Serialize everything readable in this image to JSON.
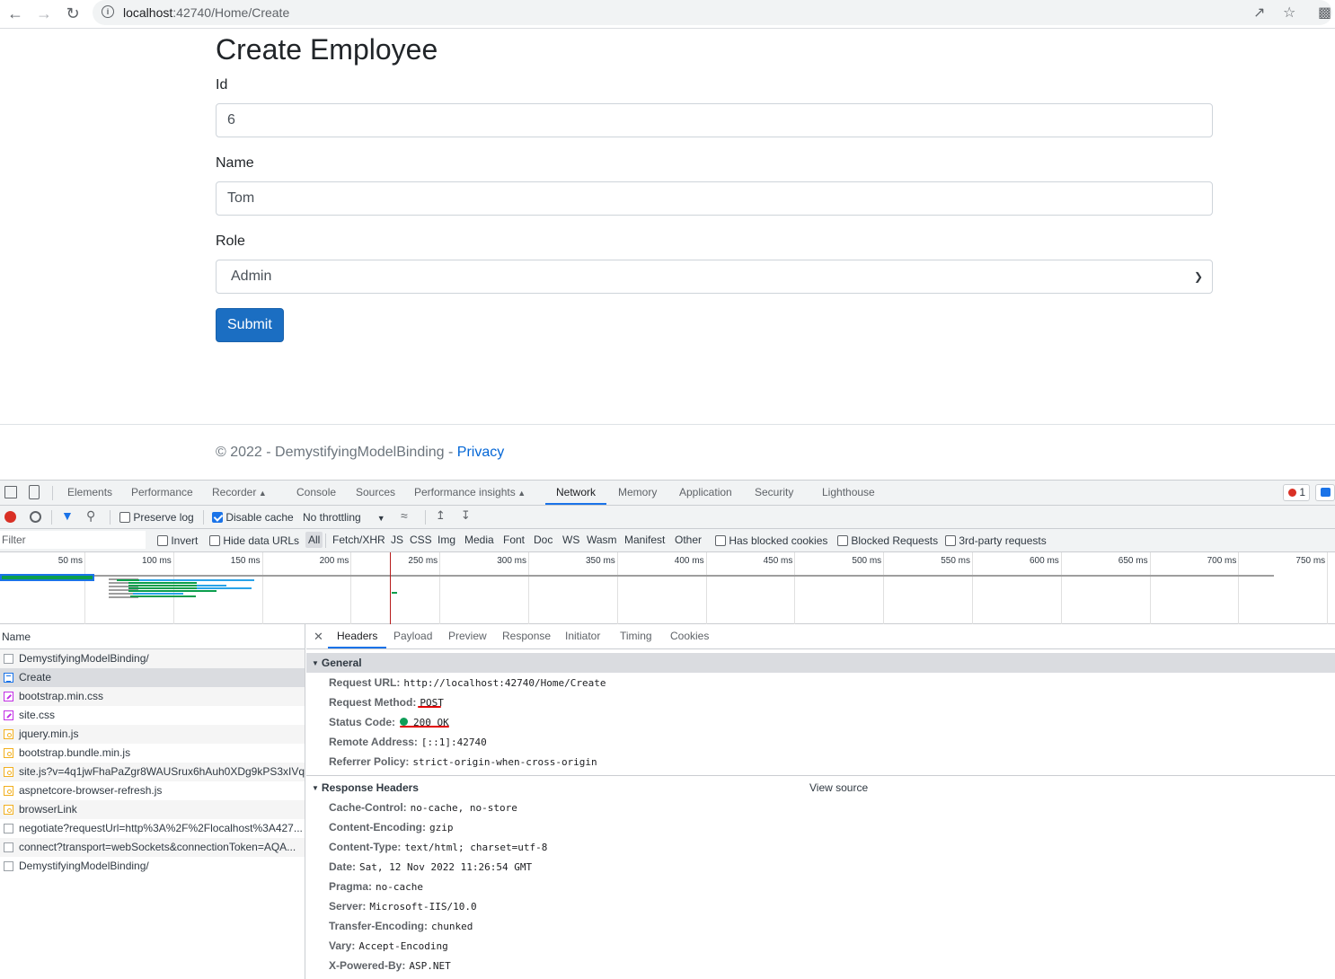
{
  "browser": {
    "url_host": "localhost",
    "url_rest": ":42740/Home/Create",
    "icons": {
      "back": "arrow-left-icon",
      "forward": "arrow-right-icon",
      "reload": "reload-icon",
      "site_info": "info-icon",
      "share": "share-icon",
      "bookmark": "star-icon",
      "extensions": "puzzle-icon"
    }
  },
  "page": {
    "title": "Create Employee",
    "fields": [
      {
        "label": "Id",
        "value": "6"
      },
      {
        "label": "Name",
        "value": "Tom"
      }
    ],
    "role": {
      "label": "Role",
      "selected": "Admin"
    },
    "submit_label": "Submit",
    "footer": {
      "text": "© 2022 - DemystifyingModelBinding - ",
      "link": "Privacy"
    }
  },
  "devtools": {
    "tabs": [
      "Elements",
      "Performance",
      "Recorder",
      "Console",
      "Sources",
      "Performance insights",
      "Network",
      "Memory",
      "Application",
      "Security",
      "Lighthouse"
    ],
    "active_tab": "Network",
    "error_count": "1",
    "toolbar": {
      "preserve_log": "Preserve log",
      "preserve_log_checked": false,
      "disable_cache": "Disable cache",
      "disable_cache_checked": true,
      "throttling": "No throttling"
    },
    "filterbar": {
      "placeholder": "Filter",
      "invert": "Invert",
      "hide_data_urls": "Hide data URLs",
      "types": [
        "All",
        "Fetch/XHR",
        "JS",
        "CSS",
        "Img",
        "Media",
        "Font",
        "Doc",
        "WS",
        "Wasm",
        "Manifest",
        "Other"
      ],
      "active_type": "All",
      "has_blocked_cookies": "Has blocked cookies",
      "blocked_requests": "Blocked Requests",
      "third_party": "3rd-party requests"
    },
    "overview_ticks": [
      "50 ms",
      "100 ms",
      "150 ms",
      "200 ms",
      "250 ms",
      "300 ms",
      "350 ms",
      "400 ms",
      "450 ms",
      "500 ms",
      "550 ms",
      "600 ms",
      "650 ms",
      "700 ms",
      "750 ms"
    ],
    "requests_header": "Name",
    "requests": [
      {
        "name": "DemystifyingModelBinding/",
        "type": "other"
      },
      {
        "name": "Create",
        "type": "doc",
        "selected": true
      },
      {
        "name": "bootstrap.min.css",
        "type": "css"
      },
      {
        "name": "site.css",
        "type": "css"
      },
      {
        "name": "jquery.min.js",
        "type": "js"
      },
      {
        "name": "bootstrap.bundle.min.js",
        "type": "js"
      },
      {
        "name": "site.js?v=4q1jwFhaPaZgr8WAUSrux6hAuh0XDg9kPS3xIVq...",
        "type": "js"
      },
      {
        "name": "aspnetcore-browser-refresh.js",
        "type": "js"
      },
      {
        "name": "browserLink",
        "type": "js"
      },
      {
        "name": "negotiate?requestUrl=http%3A%2F%2Flocalhost%3A427...",
        "type": "other"
      },
      {
        "name": "connect?transport=webSockets&connectionToken=AQA...",
        "type": "other"
      },
      {
        "name": "DemystifyingModelBinding/",
        "type": "other"
      }
    ],
    "detail_tabs": [
      "Headers",
      "Payload",
      "Preview",
      "Response",
      "Initiator",
      "Timing",
      "Cookies"
    ],
    "active_detail_tab": "Headers",
    "general": {
      "title": "General",
      "rows": [
        {
          "k": "Request URL:",
          "v": "http://localhost:42740/Home/Create"
        },
        {
          "k": "Request Method:",
          "v": "POST"
        },
        {
          "k": "Status Code:",
          "v": "200 OK"
        },
        {
          "k": "Remote Address:",
          "v": "[::1]:42740"
        },
        {
          "k": "Referrer Policy:",
          "v": "strict-origin-when-cross-origin"
        }
      ]
    },
    "response_headers": {
      "title": "Response Headers",
      "view_source": "View source",
      "rows": [
        {
          "k": "Cache-Control:",
          "v": "no-cache, no-store"
        },
        {
          "k": "Content-Encoding:",
          "v": "gzip"
        },
        {
          "k": "Content-Type:",
          "v": "text/html; charset=utf-8"
        },
        {
          "k": "Date:",
          "v": "Sat, 12 Nov 2022 11:26:54 GMT"
        },
        {
          "k": "Pragma:",
          "v": "no-cache"
        },
        {
          "k": "Server:",
          "v": "Microsoft-IIS/10.0"
        },
        {
          "k": "Transfer-Encoding:",
          "v": "chunked"
        },
        {
          "k": "Vary:",
          "v": "Accept-Encoding"
        },
        {
          "k": "X-Powered-By:",
          "v": "ASP.NET"
        }
      ]
    }
  }
}
